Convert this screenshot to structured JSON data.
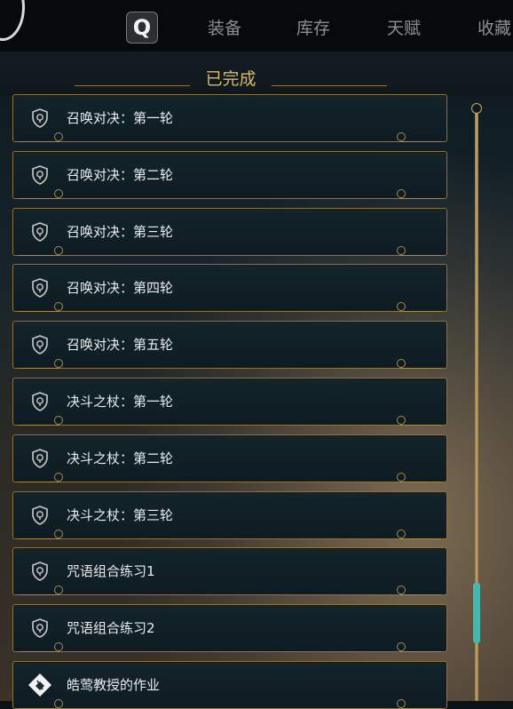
{
  "nav": {
    "q_key": "Q",
    "tabs": [
      "装备",
      "库存",
      "天赋",
      "收藏"
    ]
  },
  "section": {
    "title": "已完成"
  },
  "quests": [
    {
      "label": "召唤对决：第一轮",
      "icon": "shield-icon"
    },
    {
      "label": "召唤对决：第二轮",
      "icon": "shield-icon"
    },
    {
      "label": "召唤对决：第三轮",
      "icon": "shield-icon"
    },
    {
      "label": "召唤对决：第四轮",
      "icon": "shield-icon"
    },
    {
      "label": "召唤对决：第五轮",
      "icon": "shield-icon"
    },
    {
      "label": "决斗之杖：第一轮",
      "icon": "shield-icon"
    },
    {
      "label": "决斗之杖：第二轮",
      "icon": "shield-icon"
    },
    {
      "label": "决斗之杖：第三轮",
      "icon": "shield-icon"
    },
    {
      "label": "咒语组合练习1",
      "icon": "shield-icon"
    },
    {
      "label": "咒语组合练习2",
      "icon": "shield-icon"
    },
    {
      "label": "皓莺教授的作业",
      "icon": "diamond-quest-icon"
    }
  ],
  "colors": {
    "accent_gold": "#d9b96a",
    "scroll_thumb": "#43b7b0"
  }
}
